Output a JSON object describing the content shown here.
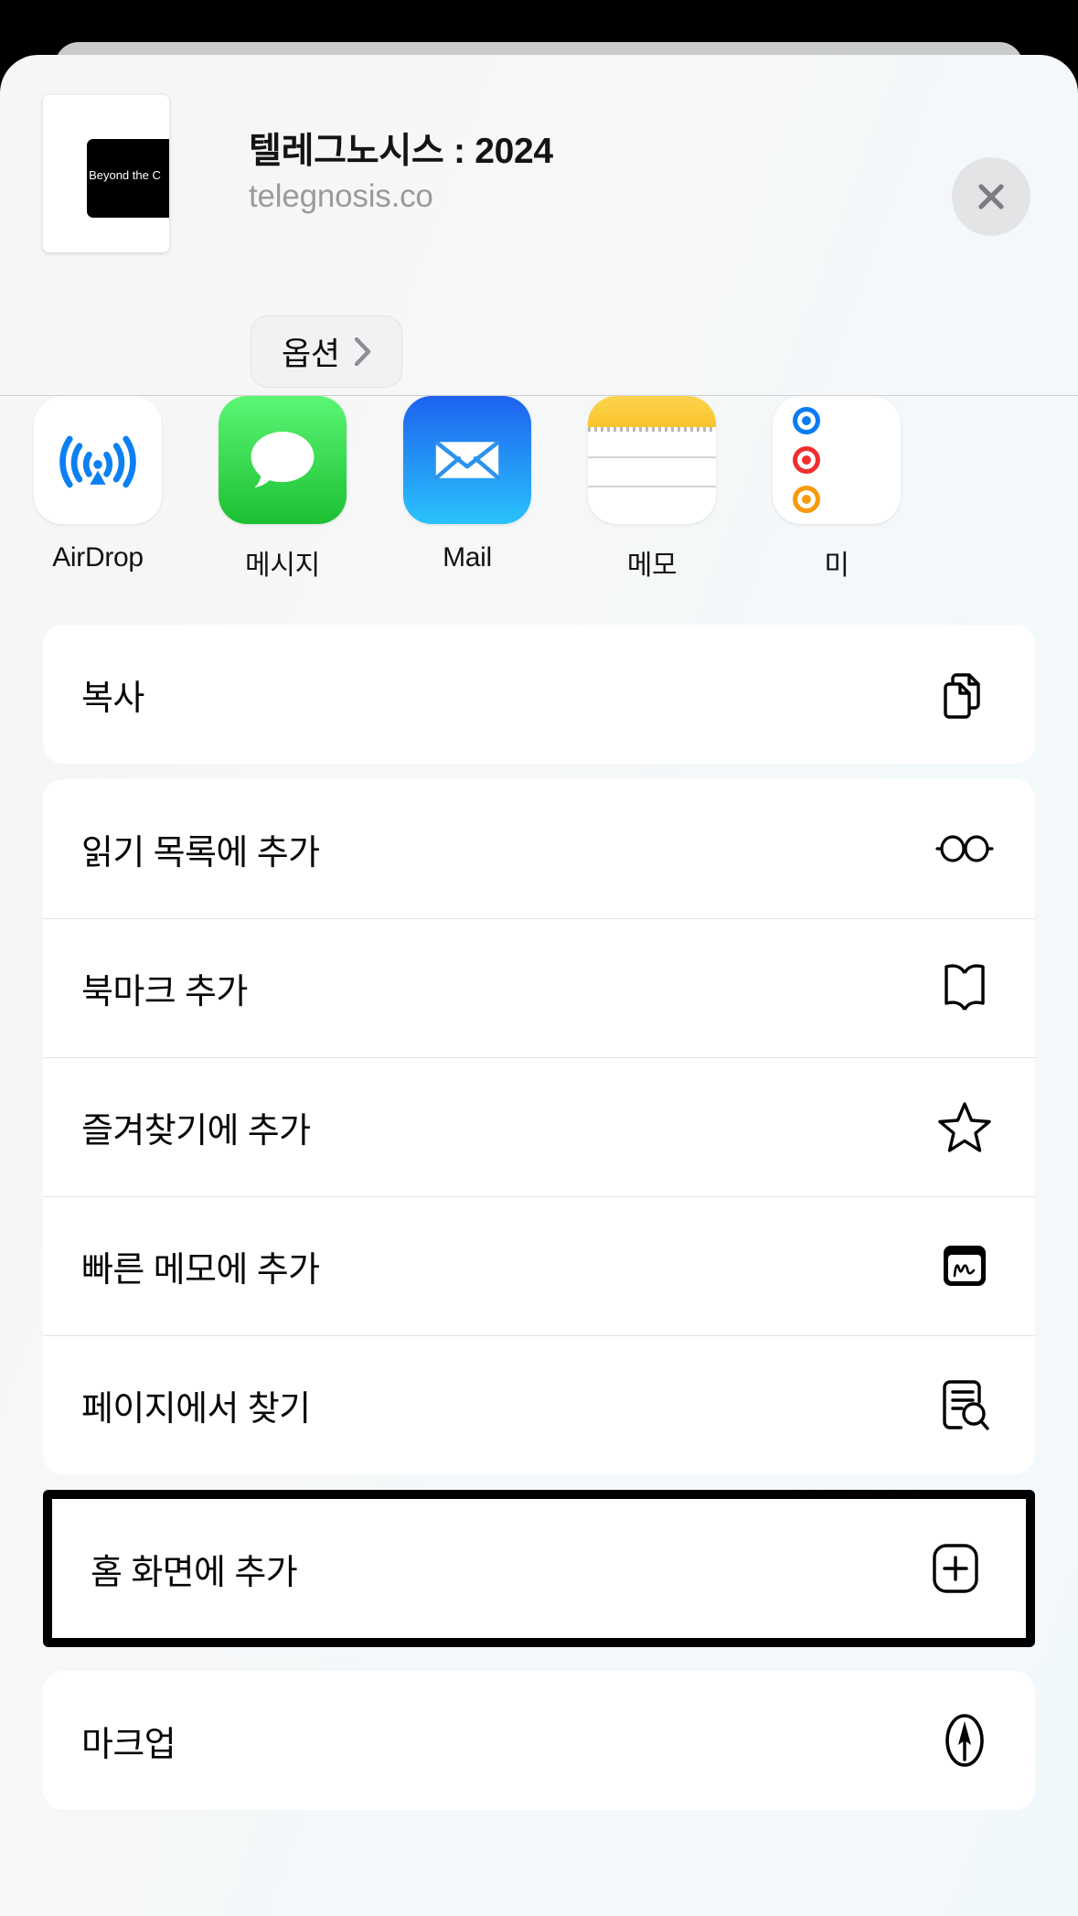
{
  "background_color": "#000000",
  "sheet": {
    "background_color": "#f5f7f9",
    "header": {
      "title": "텔레그노시스 : 2024",
      "subtitle": "telegnosis.co",
      "options_button": {
        "label": "옵션",
        "chevron_icon": "chevron-right-icon"
      },
      "close_button": {
        "icon": "close-icon",
        "background_color": "#e4e4e6"
      },
      "thumbnail": {
        "icon": "page-thumbnail",
        "caption_fragment": "ng Beyond the C"
      }
    },
    "apps": [
      {
        "label": "AirDrop",
        "icon": "airdrop-icon",
        "accent_color": "#0c80f2"
      },
      {
        "label": "메시지",
        "icon": "messages-icon",
        "accent_color": "#2ac239"
      },
      {
        "label": "Mail",
        "icon": "mail-icon",
        "accent_color": "#1f6cf0"
      },
      {
        "label": "메모",
        "icon": "notes-icon",
        "accent_color": "#f9c32b"
      },
      {
        "label": "미",
        "icon": "reminders-icon",
        "accent_color": "#0a7cf0"
      }
    ],
    "action_groups": [
      {
        "rows": [
          {
            "label": "복사",
            "icon": "copy-icon",
            "highlighted": false
          }
        ]
      },
      {
        "rows": [
          {
            "label": "읽기 목록에 추가",
            "icon": "glasses-icon",
            "highlighted": false
          },
          {
            "label": "북마크 추가",
            "icon": "book-icon",
            "highlighted": false
          },
          {
            "label": "즐겨찾기에 추가",
            "icon": "star-icon",
            "highlighted": false
          },
          {
            "label": "빠른 메모에 추가",
            "icon": "quicknote-icon",
            "highlighted": false
          },
          {
            "label": "페이지에서 찾기",
            "icon": "find-page-icon",
            "highlighted": false
          }
        ]
      },
      {
        "highlighted": true,
        "highlight_color": "#000000",
        "rows": [
          {
            "label": "홈 화면에 추가",
            "icon": "add-plus-icon",
            "highlighted": true
          }
        ]
      },
      {
        "rows": [
          {
            "label": "마크업",
            "icon": "markup-icon",
            "highlighted": false
          }
        ]
      }
    ]
  }
}
